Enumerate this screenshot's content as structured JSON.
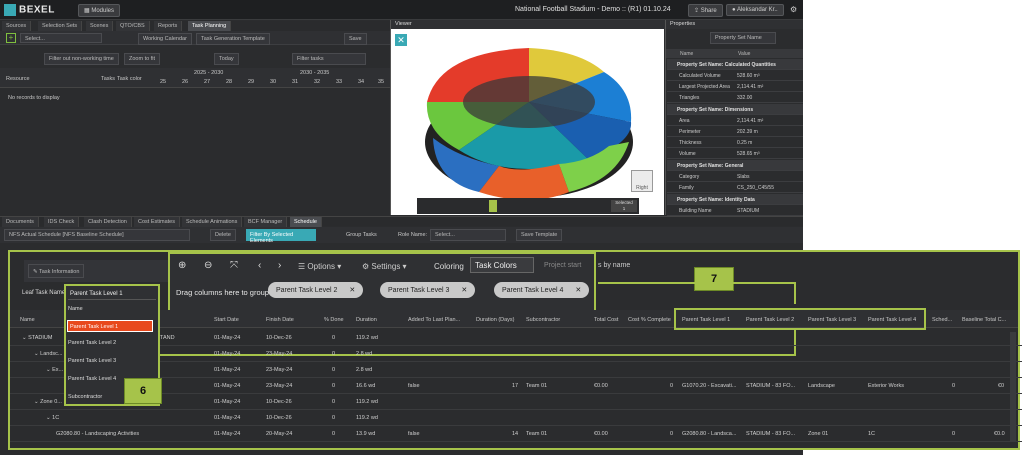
{
  "app": {
    "logo": "BEXEL",
    "modules": "Modules",
    "title": "National Football Stadium - Demo :: (R1) 01.10.24",
    "share": "Share",
    "user": "Aleksandar Kr.."
  },
  "top_tabs": [
    "Sources",
    "Selection Sets",
    "Scenes",
    "QTO/CBS",
    "Reports",
    "Task Planning"
  ],
  "viewer_title": "Viewer",
  "properties": {
    "title": "Properties",
    "set_name": "Property Set Name",
    "col_name": "Name",
    "col_value": "Value",
    "sections": [
      {
        "name": "Property Set Name: Calculated Quantities",
        "rows": [
          [
            "Calculated Volume",
            "528.60 m³"
          ],
          [
            "Largest Projected Area",
            "2,114.41 m²"
          ],
          [
            "Triangles",
            "332.00"
          ]
        ]
      },
      {
        "name": "Property Set Name: Dimensions",
        "rows": [
          [
            "Area",
            "2,114.41 m²"
          ],
          [
            "Perimeter",
            "202.39 m"
          ],
          [
            "Thickness",
            "0.25 m"
          ],
          [
            "Volume",
            "528.65 m³"
          ]
        ]
      },
      {
        "name": "Property Set Name: General",
        "rows": [
          [
            "Category",
            "Slabs"
          ],
          [
            "Family",
            "CS_250_C45/55"
          ]
        ]
      },
      {
        "name": "Property Set Name: Identity Data",
        "rows": [
          [
            "Building Name",
            "STADIUM"
          ]
        ]
      }
    ]
  },
  "planning": {
    "select": "Select...",
    "working_calendar": "Working Calendar",
    "task_template": "Task Generation Template",
    "save": "Save",
    "filter_non_working": "Filter out non-working time",
    "zoom": "Zoom to fit",
    "today": "Today",
    "filter_tasks": "Filter tasks",
    "resource": "Resource",
    "tasks": "Tasks",
    "task_color": "Task color",
    "no_records": "No records to display",
    "years": [
      "2025 - 2030",
      "2030 - 2035"
    ],
    "ticks": [
      "25",
      "26",
      "27",
      "28",
      "29",
      "30",
      "31",
      "32",
      "33",
      "34",
      "35"
    ]
  },
  "bottom_tabs": [
    "Documents",
    "IDS Check",
    "Clash Detection",
    "Cost Estimates",
    "Schedule Animations",
    "BCF Manager",
    "Schedule"
  ],
  "schedule": {
    "name": "NFS Actual Schedule [NFS Baseline Schedule]",
    "delete": "Delete",
    "filter_sel": "Filter By Selected Elements",
    "group_tasks": "Group Tasks",
    "role_name": "Role Name:",
    "select": "Select...",
    "save_template": "Save Template",
    "task_info": "Task Information",
    "options": "Options",
    "settings": "Settings",
    "coloring": "Coloring",
    "task_colors": "Task Colors",
    "project_start": "Project start",
    "sort": "s by name",
    "drag_group": "Drag columns here to group",
    "leaf_task": "Leaf Task Name",
    "parent_level": "Parent Task Level 1",
    "group_pills": [
      "Parent Task Level 2",
      "Parent Task Level 3",
      "Parent Task Level 4"
    ],
    "dropdown": [
      "Name",
      "Parent Task Level 1",
      "Parent Task Level 2",
      "Parent Task Level 3",
      "Parent Task Level 4",
      "Subcontractor"
    ],
    "columns": [
      "Name",
      "Start Date",
      "Finish Date",
      "% Done",
      "Duration",
      "Added To Last Plan...",
      "Duration (Days)",
      "Subcontractor",
      "Total Cost",
      "Cost % Complete",
      "Parent Task Level 1",
      "Parent Task Level 2",
      "Parent Task Level 3",
      "Parent Task Level 4",
      "Sched...",
      "Baseline Total C..."
    ],
    "rows": [
      {
        "name": "STADIUM",
        "name2": "TAND",
        "start": "01-May-24",
        "finish": "10-Dec-26",
        "done": "0",
        "dur": "119.2 wd"
      },
      {
        "name": "Landsc...",
        "start": "01-May-24",
        "finish": "23-May-24",
        "done": "0",
        "dur": "2.8 wd"
      },
      {
        "name": "Ex...",
        "start": "01-May-24",
        "finish": "23-May-24",
        "done": "0",
        "dur": "2.8 wd"
      },
      {
        "name": "",
        "start": "01-May-24",
        "finish": "23-May-24",
        "done": "0",
        "dur": "16.6 wd",
        "added": "false",
        "days": "17",
        "sub": "Team 01",
        "cost": "€0.00",
        "cpc": "0",
        "p1": "G1070.20 - Excavati...",
        "p2": "STADIUM - 83 FO...",
        "p3": "Landscape",
        "p4": "Exterior Works",
        "sched": "0",
        "btc": "€0"
      },
      {
        "name": "Zone 0...",
        "start": "01-May-24",
        "finish": "10-Dec-26",
        "done": "0",
        "dur": "119.2 wd"
      },
      {
        "name": "1C",
        "start": "01-May-24",
        "finish": "10-Dec-26",
        "done": "0",
        "dur": "119.2 wd"
      },
      {
        "name": "G2080.80 - Landscaping Activities",
        "start": "01-May-24",
        "finish": "20-May-24",
        "done": "0",
        "dur": "13.9 wd",
        "added": "false",
        "days": "14",
        "sub": "Team 01",
        "cost": "€0.00",
        "cpc": "0",
        "p1": "G2080.80 - Landsca...",
        "p2": "STADIUM - 83 FO...",
        "p3": "Zone 01",
        "p4": "1C",
        "sched": "0",
        "btc": "€0.0"
      }
    ]
  },
  "callouts": {
    "six": "6",
    "seven": "7"
  },
  "colors": {
    "accent": "#a6c34a",
    "teal": "#39a9b5",
    "select": "#e8491d"
  }
}
